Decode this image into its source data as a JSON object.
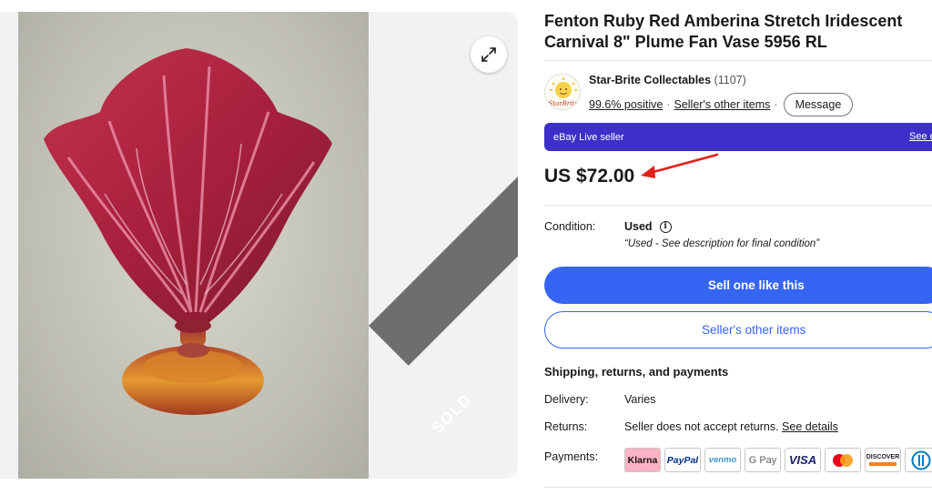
{
  "listing": {
    "title": "Fenton Ruby Red Amberina Stretch Iridescent Carnival 8\" Plume Fan Vase 5956 RL",
    "sold_label": "SOLD"
  },
  "seller": {
    "logo_text": "StarBrite",
    "name": "Star-Brite Collectables",
    "feedback_count": "(1107)",
    "positive": "99.6% positive",
    "other_items_link": "Seller's other items",
    "message_button": "Message"
  },
  "live_bar": {
    "label": "eBay Live seller",
    "link": "See e"
  },
  "price": "US $72.00",
  "condition": {
    "label": "Condition:",
    "value": "Used",
    "note": "“Used - See description for final condition”"
  },
  "buttons": {
    "sell_one": "Sell one like this",
    "seller_other_items": "Seller's other items"
  },
  "shipping": {
    "heading": "Shipping, returns, and payments",
    "delivery_label": "Delivery:",
    "delivery_value": "Varies",
    "returns_label": "Returns:",
    "returns_value": "Seller does not accept returns.",
    "returns_link": "See details",
    "payments_label": "Payments:"
  },
  "payments": [
    "Klarna",
    "PayPal",
    "venmo",
    "G Pay",
    "VISA",
    "",
    "DISCOVER",
    ""
  ],
  "colors": {
    "ebay_blue": "#3665f3",
    "live_purple": "#3d30c8",
    "annotation_arrow": "#e3201b"
  }
}
